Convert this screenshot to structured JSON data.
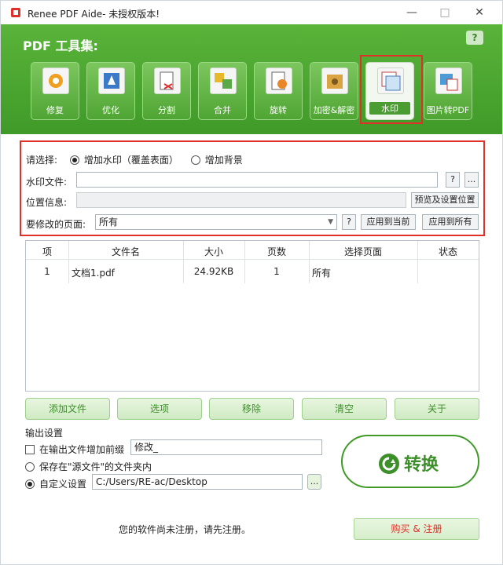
{
  "window": {
    "title": "Renee PDF Aide- 未授权版本!",
    "minimize": "—",
    "maximize": "□",
    "close": "✕"
  },
  "header": {
    "title": "PDF 工具集:",
    "help": "?"
  },
  "tools": [
    {
      "label": "修复",
      "icon": "repair-icon"
    },
    {
      "label": "优化",
      "icon": "optimize-icon"
    },
    {
      "label": "分割",
      "icon": "split-icon"
    },
    {
      "label": "合并",
      "icon": "merge-icon"
    },
    {
      "label": "旋转",
      "icon": "rotate-icon"
    },
    {
      "label": "加密&解密",
      "icon": "encrypt-icon"
    },
    {
      "label": "水印",
      "icon": "watermark-icon",
      "active": true
    },
    {
      "label": "图片转PDF",
      "icon": "image-to-pdf-icon"
    }
  ],
  "options": {
    "select_label": "请选择:",
    "radio_watermark": "增加水印（覆盖表面）",
    "radio_background": "增加背景",
    "watermark_file_label": "水印文件:",
    "watermark_file_value": "",
    "help_btn": "?",
    "browse_btn": "...",
    "position_label": "位置信息:",
    "position_value": "",
    "preview_btn": "预览及设置位置",
    "pages_label": "要修改的页面:",
    "pages_value": "所有",
    "apply_current": "应用到当前",
    "apply_all": "应用到所有"
  },
  "table": {
    "headers": [
      "项",
      "文件名",
      "大小",
      "页数",
      "选择页面",
      "状态"
    ],
    "rows": [
      {
        "index": "1",
        "name": "文档1.pdf",
        "size": "24.92KB",
        "pages": "1",
        "selection": "所有",
        "status": ""
      }
    ]
  },
  "actions": {
    "add": "添加文件",
    "options": "选项",
    "remove": "移除",
    "clear": "清空",
    "about": "关于"
  },
  "output": {
    "title": "输出设置",
    "prefix_label": "在输出文件增加前缀",
    "prefix_value": "修改_",
    "save_source": "保存在\"源文件\"的文件夹内",
    "custom_label": "自定义设置",
    "custom_path": "C:/Users/RE-ac/Desktop",
    "browse": "..."
  },
  "convert": "转换",
  "footer": {
    "notice": "您的软件尚未注册，请先注册。",
    "buy": "购买 & 注册"
  },
  "colors": {
    "green": "#3f9a28",
    "red": "#e0302a"
  }
}
